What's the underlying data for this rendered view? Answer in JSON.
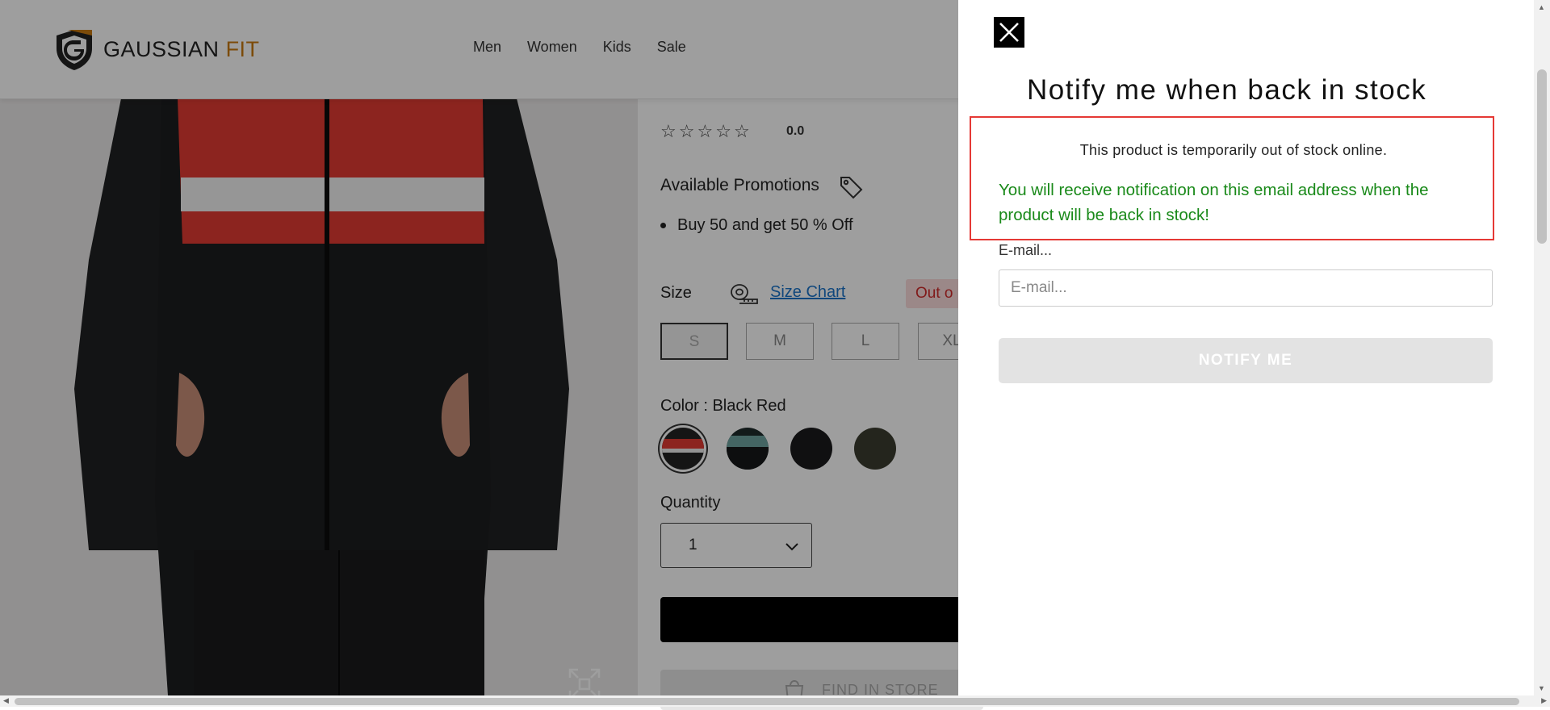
{
  "header": {
    "logo_text_main": "GAUSSIAN",
    "logo_text_accent": "FIT",
    "nav": [
      "Men",
      "Women",
      "Kids",
      "Sale"
    ]
  },
  "product": {
    "rating_value": "0.0",
    "rating_stars": 0,
    "promotions_title": "Available Promotions",
    "promotions": [
      "Buy 50 and get 50 % Off"
    ],
    "size_label": "Size",
    "size_chart_label": "Size Chart",
    "out_of_stock_badge": "Out o",
    "sizes": [
      "S",
      "M",
      "L",
      "XL"
    ],
    "color_label": "Color : Black Red",
    "quantity_label": "Quantity",
    "quantity_value": "1",
    "find_in_store_label": "FIND IN STORE"
  },
  "drawer": {
    "title": "Notify me when back in stock",
    "out_of_stock_message": "This product is temporarily out of stock online.",
    "notification_message": "You will receive notification on this email address when the product will be back in stock!",
    "email_label": "E-mail...",
    "email_placeholder": "E-mail...",
    "email_value": "",
    "notify_button_label": "NOTIFY ME"
  },
  "colors": {
    "accent_logo": "#c87a10",
    "message_border": "#e53935",
    "success_text": "#1a8a1a",
    "link": "#1a73c9",
    "out_of_stock_text": "#d12a2a"
  }
}
